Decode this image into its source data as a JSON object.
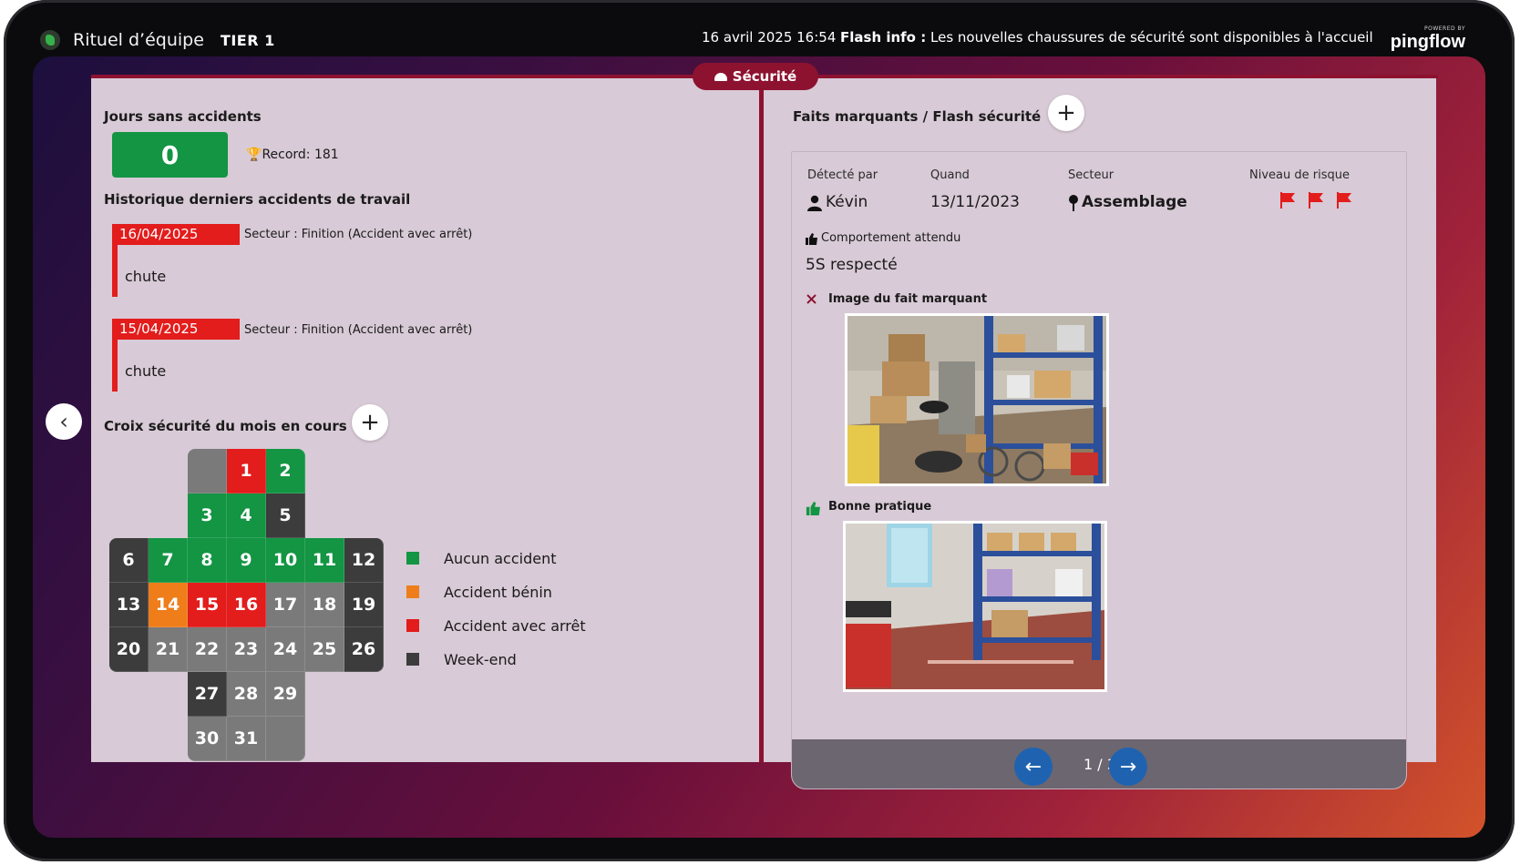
{
  "header": {
    "app_title": "Rituel d’équipe",
    "tier": "TIER 1",
    "datetime": "16 avril 2025 16:54",
    "flash_label": "Flash info :",
    "flash_text": "Les nouvelles chaussures de sécurité sont disponibles à l'accueil",
    "powered_by": "POWERED BY",
    "brand": "pingflow"
  },
  "tab": {
    "label": "Sécurité"
  },
  "left": {
    "days_title": "Jours sans accidents",
    "days_value": "0",
    "record": "Record: 181",
    "history_title": "Historique derniers accidents de travail",
    "accidents": [
      {
        "date": "16/04/2025",
        "sector": "Secteur : Finition (Accident avec arrêt)",
        "desc": "chute"
      },
      {
        "date": "15/04/2025",
        "sector": "Secteur : Finition (Accident avec arrêt)",
        "desc": "chute"
      }
    ],
    "cross_title": "Croix sécurité du mois en cours",
    "add_symbol": "+",
    "prev_symbol": "‹",
    "days": {
      "d1": "1",
      "d2": "2",
      "d3": "3",
      "d4": "4",
      "d5": "5",
      "d6": "6",
      "d7": "7",
      "d8": "8",
      "d9": "9",
      "d10": "10",
      "d11": "11",
      "d12": "12",
      "d13": "13",
      "d14": "14",
      "d15": "15",
      "d16": "16",
      "d17": "17",
      "d18": "18",
      "d19": "19",
      "d20": "20",
      "d21": "21",
      "d22": "22",
      "d23": "23",
      "d24": "24",
      "d25": "25",
      "d26": "26",
      "d27": "27",
      "d28": "28",
      "d29": "29",
      "d30": "30",
      "d31": "31"
    },
    "legend": [
      {
        "label": "Aucun accident",
        "color": "#139543"
      },
      {
        "label": "Accident bénin",
        "color": "#ef7d1a"
      },
      {
        "label": "Accident avec arrêt",
        "color": "#e31c1c"
      },
      {
        "label": "Week-end",
        "color": "#3c3c3c"
      }
    ]
  },
  "right": {
    "title": "Faits marquants / Flash sécurité",
    "add_symbol": "+",
    "cols": {
      "detected_label": "Détecté par",
      "detected_value": "Kévin",
      "when_label": "Quand",
      "when_value": "13/11/2023",
      "sector_label": "Secteur",
      "sector_value": "Assemblage",
      "risk_label": "Niveau de risque"
    },
    "risk_flags": 3,
    "behavior_label": "Comportement attendu",
    "behavior_value": "5S respecté",
    "bad_image_label": "Image du fait marquant",
    "good_image_label": "Bonne pratique",
    "pager": {
      "prev": "←",
      "next": "→",
      "text": "1 / 3"
    }
  },
  "colors": {
    "accent": "#8d1230",
    "green": "#139543",
    "red": "#e31c1c",
    "orange": "#ef7d1a",
    "weekend": "#3c3c3c",
    "future": "#7a7a7a",
    "pager_button": "#1f63b0"
  }
}
